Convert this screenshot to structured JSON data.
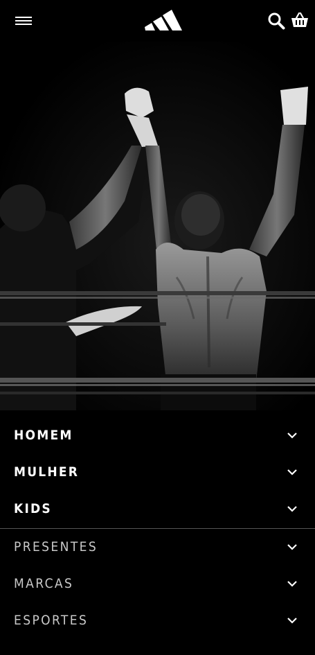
{
  "header": {
    "menu_icon": "hamburger-menu-icon",
    "logo_icon": "adidas-three-stripes-logo",
    "search_icon": "search-icon",
    "cart_icon": "basket-icon"
  },
  "hero": {
    "image": "black-and-white-boxing-victory-photo"
  },
  "nav": {
    "primary": [
      {
        "label": "HOMEM",
        "icon": "chevron-down-icon"
      },
      {
        "label": "MULHER",
        "icon": "chevron-down-icon"
      },
      {
        "label": "KIDS",
        "icon": "chevron-down-icon"
      }
    ],
    "secondary": [
      {
        "label": "PRESENTES",
        "icon": "chevron-down-icon"
      },
      {
        "label": "MARCAS",
        "icon": "chevron-down-icon"
      },
      {
        "label": "ESPORTES",
        "icon": "chevron-down-icon"
      }
    ]
  },
  "colors": {
    "background": "#000000",
    "text_primary": "#ffffff",
    "text_secondary": "#c9c9c9",
    "divider": "#555555"
  }
}
